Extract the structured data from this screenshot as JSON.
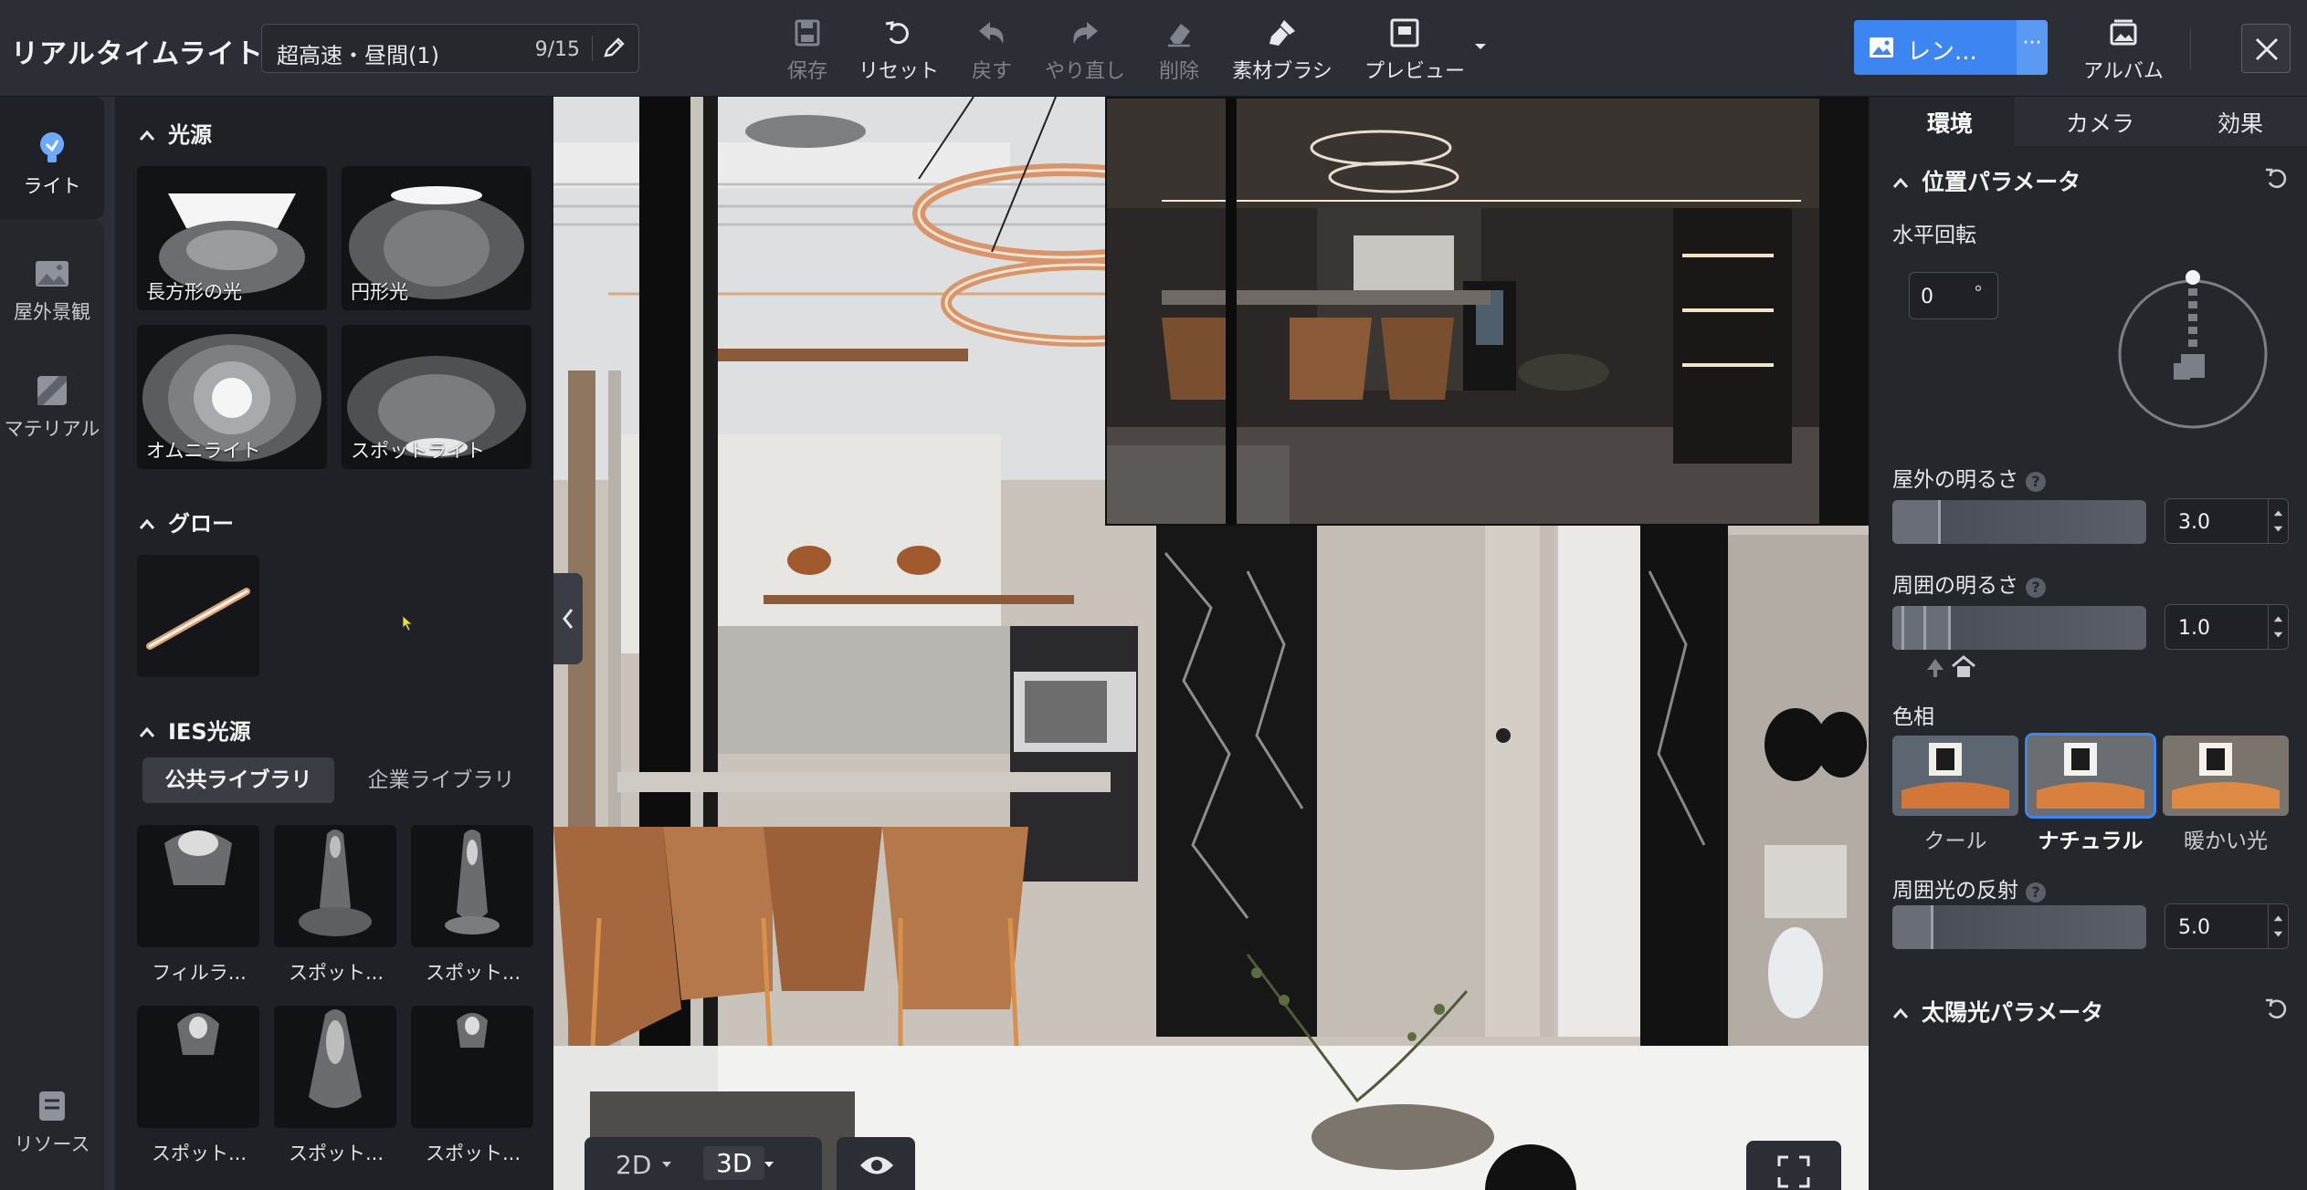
{
  "app": {
    "title": "リアルタイムライト"
  },
  "scene": {
    "name": "超高速・昼間(1)",
    "count": "9/15"
  },
  "toolbar": {
    "save": "保存",
    "reset": "リセット",
    "undo": "戻す",
    "redo": "やり直し",
    "delete": "削除",
    "brush": "素材ブラシ",
    "preview": "プレビュー",
    "render": "レン...",
    "render_more": "···",
    "album": "アルバム"
  },
  "rail": {
    "light": "ライト",
    "outdoor": "屋外景観",
    "material": "マテリアル",
    "resource": "リソース"
  },
  "left": {
    "light_source": {
      "title": "光源",
      "items": [
        "長方形の光",
        "円形光",
        "オムニライト",
        "スポットライト"
      ]
    },
    "glow": {
      "title": "グロー"
    },
    "ies": {
      "title": "IES光源",
      "tab_public": "公共ライブラリ",
      "tab_company": "企業ライブラリ",
      "items": [
        "フィルラ...",
        "スポット...",
        "スポット...",
        "スポット...",
        "スポット...",
        "スポット..."
      ]
    }
  },
  "viewport": {
    "mode_2d": "2D",
    "mode_3d": "3D"
  },
  "right": {
    "tabs": [
      "環境",
      "カメラ",
      "効果"
    ],
    "position": {
      "title": "位置パラメータ",
      "rotation_label": "水平回転",
      "rotation_value": "0",
      "rotation_unit": "°"
    },
    "outdoor_brightness": {
      "label": "屋外の明るさ",
      "value": "3.0",
      "level": 0.18
    },
    "ambient_brightness": {
      "label": "周囲の明るさ",
      "value": "1.0",
      "level": 0.22
    },
    "hue": {
      "label": "色相",
      "options": [
        "クール",
        "ナチュラル",
        "暖かい光"
      ],
      "selected": "ナチュラル"
    },
    "ambient_reflection": {
      "label": "周囲光の反射",
      "value": "5.0",
      "level": 0.15
    },
    "sun": {
      "title": "太陽光パラメータ"
    }
  },
  "colors": {
    "accent": "#3d86f2",
    "panel": "#24272c",
    "topbar": "#2b2e34"
  }
}
